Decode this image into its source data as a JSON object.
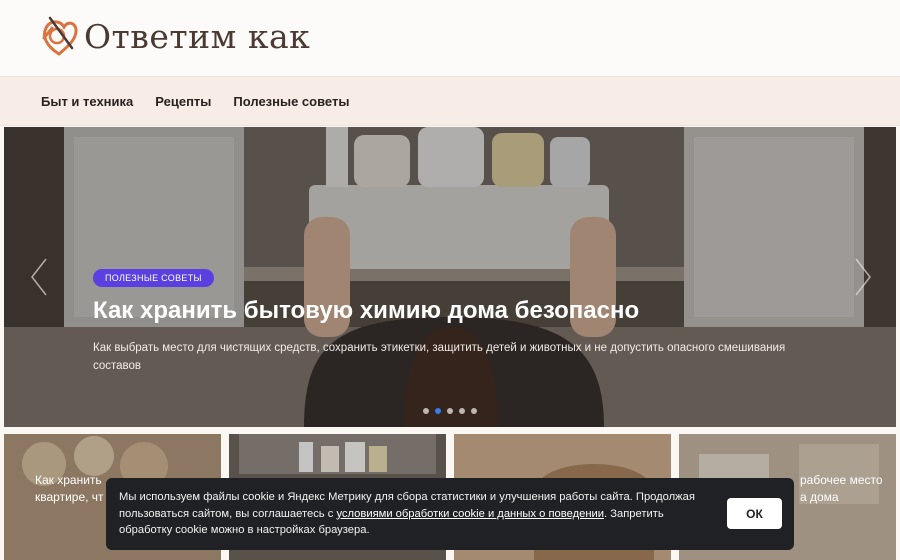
{
  "site": {
    "logo_text": "Ответим как"
  },
  "nav": {
    "items": [
      "Быт и техника",
      "Рецепты",
      "Полезные советы"
    ]
  },
  "hero": {
    "badge": "ПОЛЕЗНЫЕ СОВЕТЫ",
    "title": "Как хранить бытовую химию дома безопасно",
    "description": "Как выбрать место для чистящих средств, сохранить этикетки, защитить детей и животных и не допустить опасного смешивания составов",
    "slide_count": 5,
    "active_slide": 2
  },
  "cards": [
    {
      "title_line1": "Как хранить",
      "title_line2": "квартире, чт"
    },
    {
      "title_line1": "",
      "title_line2": ""
    },
    {
      "title_line1": "",
      "title_line2": ""
    },
    {
      "title_line1": "рабочее место",
      "title_line2": "а дома"
    }
  ],
  "cookie": {
    "text_before": "Мы используем файлы cookie и Яндекс Метрику для сбора статистики и улучшения работы сайта. Продолжая пользоваться сайтом, вы соглашаетесь с ",
    "link": "условиями обработки cookie и данных о поведении",
    "text_after": ". Запретить обработку cookie можно в настройках браузера.",
    "button": "ОК"
  },
  "colors": {
    "badge": "#5b3fe0",
    "dot_active": "#2f7ff0",
    "logo_accent": "#d9733f",
    "cookie_bg": "#1f2125"
  }
}
